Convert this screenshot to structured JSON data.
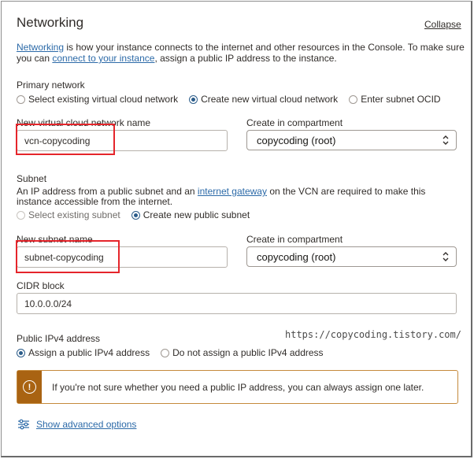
{
  "section": {
    "title": "Networking",
    "collapse_label": "Collapse",
    "description": {
      "link1": "Networking",
      "text1": " is how your instance connects to the internet and other resources in the Console. To make sure you can ",
      "link2": "connect to your instance",
      "text2": ", assign a public IP address to the instance."
    }
  },
  "primary_network": {
    "label": "Primary network",
    "options": [
      {
        "label": "Select existing virtual cloud network",
        "selected": false
      },
      {
        "label": "Create new virtual cloud network",
        "selected": true
      },
      {
        "label": "Enter subnet OCID",
        "selected": false
      }
    ],
    "vcn_name_label": "New virtual cloud network name",
    "vcn_name_value": "vcn-copycoding",
    "compartment_label": "Create in compartment",
    "compartment_value": "copycoding  (root)"
  },
  "subnet": {
    "label": "Subnet",
    "description_pre": "An IP address from a public subnet and an ",
    "description_link": "internet gateway",
    "description_post": " on the VCN are required to make this instance accessible from the internet.",
    "options": [
      {
        "label": "Select existing subnet",
        "selected": false,
        "disabled": true
      },
      {
        "label": "Create new public subnet",
        "selected": true,
        "disabled": false
      }
    ],
    "subnet_name_label": "New subnet name",
    "subnet_name_value": "subnet-copycoding",
    "compartment_label": "Create in compartment",
    "compartment_value": "copycoding  (root)",
    "cidr_label": "CIDR block",
    "cidr_value": "10.0.0.0/24"
  },
  "public_ip": {
    "label": "Public IPv4 address",
    "options": [
      {
        "label": "Assign a public IPv4 address",
        "selected": true
      },
      {
        "label": "Do not assign a public IPv4 address",
        "selected": false
      }
    ]
  },
  "watermark": "https://copycoding.tistory.com/",
  "alert": {
    "icon": "warning-icon",
    "text": "If you're not sure whether you need a public IP address, you can always assign one later."
  },
  "advanced": {
    "icon": "sliders-icon",
    "label": "Show advanced options"
  },
  "colors": {
    "link": "#2c6aa8",
    "highlight_box": "#e5252b",
    "warning": "#a96312"
  }
}
